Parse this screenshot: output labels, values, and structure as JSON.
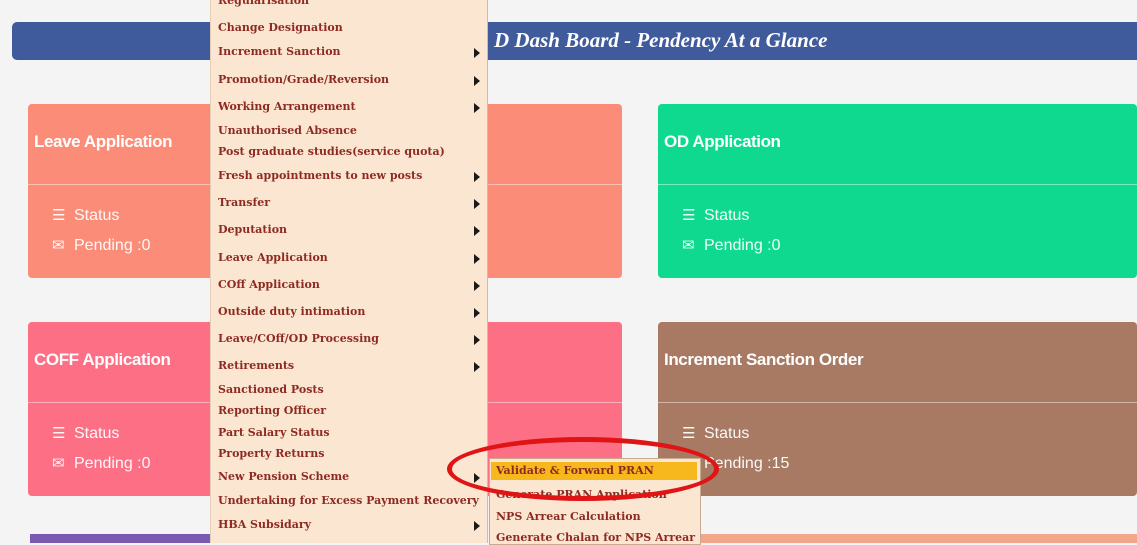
{
  "banner": {
    "title": "D Dash Board - Pendency At a Glance"
  },
  "cards": {
    "leave": {
      "title": "Leave Application",
      "status_label": "Status",
      "pending_text": "Pending :0"
    },
    "coff": {
      "title": "COFF Application",
      "status_label": "Status",
      "pending_text": "Pending :0"
    },
    "od": {
      "title": "OD Application",
      "status_label": "Status",
      "pending_text": "Pending :0"
    },
    "increment": {
      "title": "Increment Sanction Order",
      "status_label": "Status",
      "pending_text": "Pending :15"
    }
  },
  "menu": {
    "items": [
      {
        "label": "Regularisation",
        "has_submenu": false
      },
      {
        "label": "Change Designation",
        "has_submenu": false
      },
      {
        "label": "Increment Sanction",
        "has_submenu": true
      },
      {
        "label": "Promotion/Grade/Reversion",
        "has_submenu": true
      },
      {
        "label": "Working Arrangement",
        "has_submenu": true
      },
      {
        "label": "Unauthorised Absence",
        "has_submenu": false
      },
      {
        "label": "Post graduate studies(service quota)",
        "has_submenu": false
      },
      {
        "label": "Fresh appointments to new posts",
        "has_submenu": true
      },
      {
        "label": "Transfer",
        "has_submenu": true
      },
      {
        "label": "Deputation",
        "has_submenu": true
      },
      {
        "label": "Leave Application",
        "has_submenu": true
      },
      {
        "label": "COff Application",
        "has_submenu": true
      },
      {
        "label": "Outside duty intimation",
        "has_submenu": true
      },
      {
        "label": "Leave/COff/OD Processing",
        "has_submenu": true
      },
      {
        "label": "Retirements",
        "has_submenu": true
      },
      {
        "label": "Sanctioned Posts",
        "has_submenu": false
      },
      {
        "label": "Reporting Officer",
        "has_submenu": false
      },
      {
        "label": "Part Salary Status",
        "has_submenu": false
      },
      {
        "label": "Property Returns",
        "has_submenu": false
      },
      {
        "label": "New Pension Scheme",
        "has_submenu": true
      },
      {
        "label": "Undertaking for Excess Payment Recovery",
        "has_submenu": false
      },
      {
        "label": "HBA Subsidary",
        "has_submenu": true
      }
    ]
  },
  "submenu": {
    "items": [
      {
        "label": "Validate & Forward PRAN",
        "highlighted": true
      },
      {
        "label": "Generate PRAN Application",
        "highlighted": false
      },
      {
        "label": "NPS Arrear Calculation",
        "highlighted": false
      },
      {
        "label": "Generate Chalan for NPS Arrear",
        "highlighted": false
      }
    ]
  },
  "colors": {
    "banner": "#3f5b9c",
    "leave_card": "#fa8c78",
    "coff_card": "#fc6f84",
    "od_card": "#0fd98f",
    "increment_card": "#a87a64",
    "menu_bg": "#fbe7d1",
    "menu_text": "#8e2a22",
    "highlight": "#f7b81e",
    "annotation": "#e01414"
  },
  "icons": {
    "status": "list-icon",
    "pending": "envelope-icon",
    "submenu": "caret-right-icon"
  }
}
